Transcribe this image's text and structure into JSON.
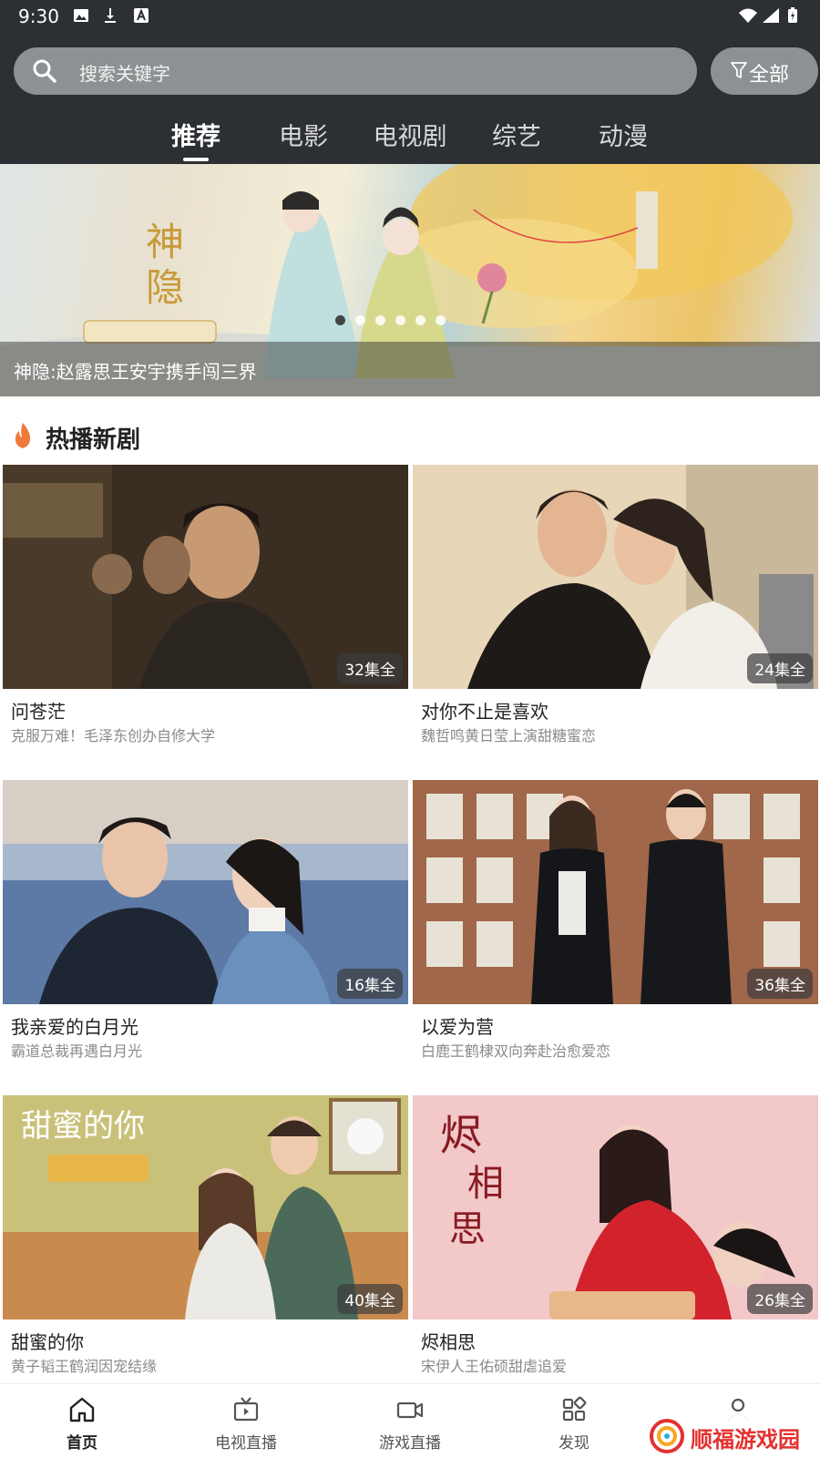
{
  "status_bar": {
    "time": "9:30"
  },
  "search": {
    "placeholder": "搜索关键字",
    "filter_label": "全部"
  },
  "tabs": [
    {
      "label": "推荐",
      "active": true
    },
    {
      "label": "电影",
      "active": false
    },
    {
      "label": "电视剧",
      "active": false
    },
    {
      "label": "综艺",
      "active": false
    },
    {
      "label": "动漫",
      "active": false
    }
  ],
  "banner": {
    "caption": "神隐:赵露思王安宇携手闯三界",
    "slide_count": 6,
    "active_slide": 1
  },
  "section": {
    "title": "热播新剧",
    "icon": "fire-icon",
    "icon_color": "#f07a3a"
  },
  "shows": [
    {
      "title": "问苍茫",
      "subtitle": "克服万难！毛泽东创办自修大学",
      "episodes": "32集全"
    },
    {
      "title": "对你不止是喜欢",
      "subtitle": "魏哲鸣黄日莹上演甜糖蜜恋",
      "episodes": "24集全"
    },
    {
      "title": "我亲爱的白月光",
      "subtitle": "霸道总裁再遇白月光",
      "episodes": "16集全"
    },
    {
      "title": "以爱为营",
      "subtitle": "白鹿王鹤棣双向奔赴治愈爱恋",
      "episodes": "36集全"
    },
    {
      "title": "甜蜜的你",
      "subtitle": "黄子韬王鹤润因宠结缘",
      "episodes": "40集全"
    },
    {
      "title": "烬相思",
      "subtitle": "宋伊人王佑硕甜虐追爱",
      "episodes": "26集全"
    }
  ],
  "bottom_nav": [
    {
      "label": "首页",
      "icon": "home-icon",
      "active": true
    },
    {
      "label": "电视直播",
      "icon": "tv-icon",
      "active": false
    },
    {
      "label": "游戏直播",
      "icon": "video-camera-icon",
      "active": false
    },
    {
      "label": "发现",
      "icon": "grid-icon",
      "active": false
    }
  ],
  "watermark": {
    "text": "顺福游戏园"
  },
  "colors": {
    "header_bg": "#2c2f33",
    "search_bg": "#8e9193",
    "watermark_red": "#e4312f"
  }
}
